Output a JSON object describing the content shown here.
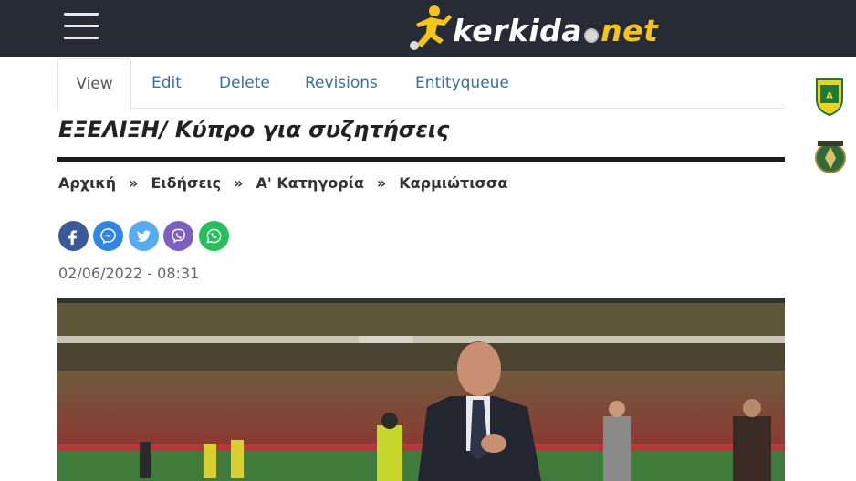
{
  "header": {
    "logo_part1": "kerkida",
    "logo_part2": "net",
    "logo_icon": "football-player-logo"
  },
  "tabs": [
    {
      "label": "View"
    },
    {
      "label": "Edit"
    },
    {
      "label": "Delete"
    },
    {
      "label": "Revisions"
    },
    {
      "label": "Entityqueue"
    }
  ],
  "article": {
    "title": "ΕΞΕΛΙΞΗ/ Κύπρο για συζητήσεις",
    "date": "02/06/2022 - 08:31"
  },
  "breadcrumb": [
    {
      "label": "Αρχική"
    },
    {
      "label": "Ειδήσεις"
    },
    {
      "label": "Α' Κατηγορία"
    },
    {
      "label": "Καρμιώτισσα"
    }
  ],
  "breadcrumb_separator": "»",
  "share_buttons": [
    {
      "icon": "facebook-icon",
      "color": "#3b5998"
    },
    {
      "icon": "messenger-icon",
      "color": "#2f86e8"
    },
    {
      "icon": "twitter-icon",
      "color": "#55acee"
    },
    {
      "icon": "viber-icon",
      "color": "#7d5fbf"
    },
    {
      "icon": "whatsapp-icon",
      "color": "#25c05a"
    }
  ],
  "side_logos": [
    {
      "icon": "aek-larnaca-crest-icon"
    },
    {
      "icon": "omonia-aradippou-crest-icon"
    }
  ],
  "colors": {
    "topbar": "#272b36",
    "brand_yellow": "#f6c518",
    "link": "#3a6fa5"
  }
}
